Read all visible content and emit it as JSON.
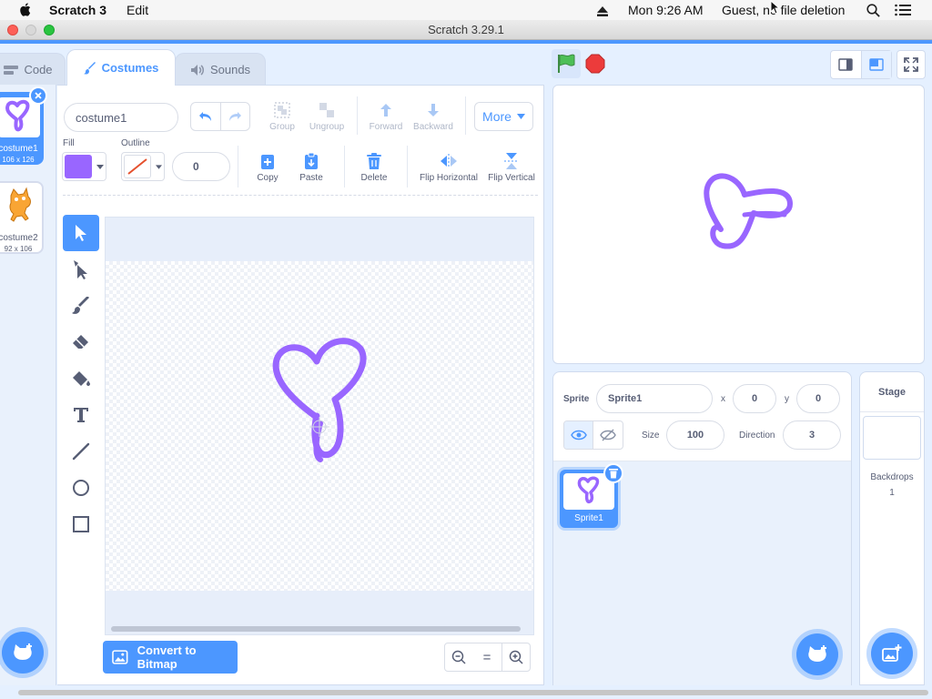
{
  "menubar": {
    "app_name": "Scratch 3",
    "edit_menu": "Edit",
    "clock": "Mon 9:26 AM",
    "user": "Guest, no file deletion"
  },
  "window": {
    "title": "Scratch 3.29.1"
  },
  "tabs": [
    {
      "label": "Code",
      "icon": "code-icon"
    },
    {
      "label": "Costumes",
      "icon": "brush-icon",
      "active": true
    },
    {
      "label": "Sounds",
      "icon": "speaker-icon"
    }
  ],
  "costumes": [
    {
      "name": "costume1",
      "size": "106 x 126",
      "selected": true
    },
    {
      "name": "costume2",
      "size": "92 x 106",
      "selected": false
    }
  ],
  "editor": {
    "costume_name": "costume1",
    "fill_label": "Fill",
    "outline_label": "Outline",
    "outline_width": "0",
    "fill_color": "#9966ff",
    "buttons": {
      "group": "Group",
      "ungroup": "Ungroup",
      "forward": "Forward",
      "backward": "Backward",
      "more": "More",
      "copy": "Copy",
      "paste": "Paste",
      "delete": "Delete",
      "flip_horizontal": "Flip Horizontal",
      "flip_vertical": "Flip Vertical"
    },
    "convert_button": "Convert to Bitmap",
    "zoom_reset": "="
  },
  "sprite": {
    "sprite_label": "Sprite",
    "name": "Sprite1",
    "x_label": "x",
    "x": "0",
    "y_label": "y",
    "y": "0",
    "size_label": "Size",
    "size": "100",
    "direction_label": "Direction",
    "direction": "3",
    "tile_name": "Sprite1"
  },
  "stage_panel": {
    "title": "Stage",
    "backdrops_label": "Backdrops",
    "backdrops_count": "1"
  },
  "colors": {
    "accent": "#4c97ff",
    "costume_purple": "#9966ff",
    "green_flag": "#4cbf56",
    "stop": "#ec3b3b"
  }
}
